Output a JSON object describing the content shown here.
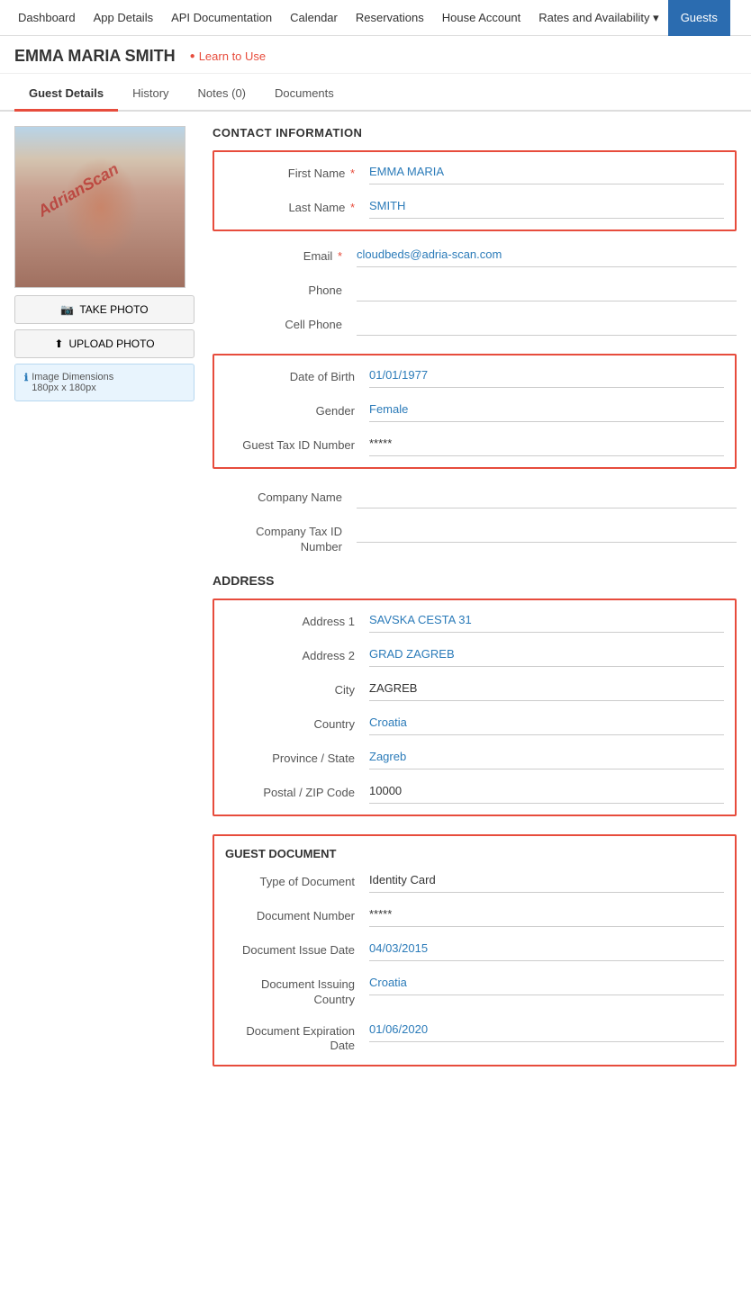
{
  "nav": {
    "items": [
      {
        "label": "Dashboard",
        "active": false
      },
      {
        "label": "App Details",
        "active": false
      },
      {
        "label": "API Documentation",
        "active": false
      },
      {
        "label": "Calendar",
        "active": false
      },
      {
        "label": "Reservations",
        "active": false
      },
      {
        "label": "House Account",
        "active": false
      },
      {
        "label": "Rates and Availability",
        "active": false,
        "dropdown": true
      },
      {
        "label": "Guests",
        "active": true
      }
    ]
  },
  "page": {
    "title": "EMMA MARIA SMITH",
    "learn_label": "Learn to Use"
  },
  "tabs": [
    {
      "label": "Guest Details",
      "active": true
    },
    {
      "label": "History",
      "active": false
    },
    {
      "label": "Notes (0)",
      "active": false
    },
    {
      "label": "Documents",
      "active": false
    }
  ],
  "left_panel": {
    "take_photo_label": "TAKE PHOTO",
    "upload_photo_label": "UPLOAD PHOTO",
    "image_info_title": "Image Dimensions",
    "image_info_value": "180px x 180px",
    "watermark": "AdrianScan"
  },
  "contact": {
    "section_title": "CONTACT INFORMATION",
    "fields": [
      {
        "label": "First Name",
        "required": true,
        "value": "EMMA MARIA",
        "color": "blue"
      },
      {
        "label": "Last Name",
        "required": true,
        "value": "SMITH",
        "color": "blue"
      },
      {
        "label": "Email",
        "required": true,
        "value": "cloudbeds@adria-scan.com",
        "color": "blue"
      },
      {
        "label": "Phone",
        "required": false,
        "value": "",
        "color": "empty"
      },
      {
        "label": "Cell Phone",
        "required": false,
        "value": "",
        "color": "empty"
      }
    ]
  },
  "personal": {
    "fields": [
      {
        "label": "Date of Birth",
        "value": "01/01/1977",
        "color": "blue"
      },
      {
        "label": "Gender",
        "value": "Female",
        "color": "blue"
      },
      {
        "label": "Guest Tax ID Number",
        "value": "*****",
        "color": "black"
      }
    ]
  },
  "company": {
    "fields": [
      {
        "label": "Company Name",
        "value": "",
        "color": "empty"
      },
      {
        "label": "Company Tax ID Number",
        "value": "",
        "color": "empty"
      }
    ]
  },
  "address": {
    "section_title": "ADDRESS",
    "fields": [
      {
        "label": "Address 1",
        "value": "SAVSKA CESTA 31",
        "color": "blue"
      },
      {
        "label": "Address 2",
        "value": "GRAD ZAGREB",
        "color": "blue"
      },
      {
        "label": "City",
        "value": "ZAGREB",
        "color": "black"
      },
      {
        "label": "Country",
        "value": "Croatia",
        "color": "blue"
      },
      {
        "label": "Province / State",
        "value": "Zagreb",
        "color": "blue"
      },
      {
        "label": "Postal / ZIP Code",
        "value": "10000",
        "color": "black"
      }
    ]
  },
  "guest_doc": {
    "section_title": "GUEST DOCUMENT",
    "fields": [
      {
        "label": "Type of Document",
        "value": "Identity Card",
        "color": "black"
      },
      {
        "label": "Document Number",
        "value": "*****",
        "color": "black"
      },
      {
        "label": "Document Issue Date",
        "value": "04/03/2015",
        "color": "blue"
      },
      {
        "label": "Document Issuing Country",
        "value": "Croatia",
        "color": "blue"
      },
      {
        "label": "Document Expiration Date",
        "value": "01/06/2020",
        "color": "blue"
      }
    ]
  }
}
